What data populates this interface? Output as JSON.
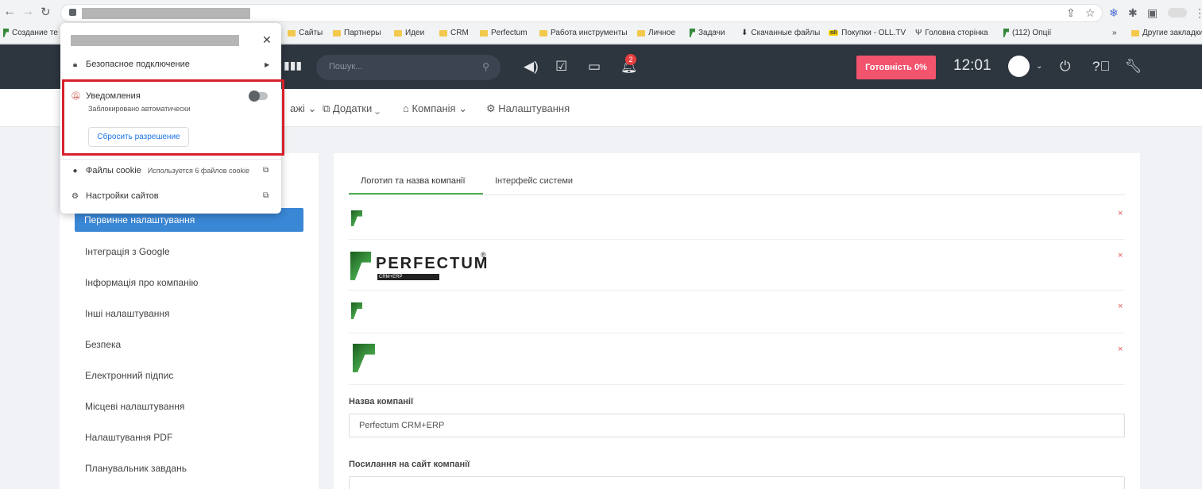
{
  "browser": {
    "bookmarks": [
      "Создание те",
      "Сайты",
      "Партнеры",
      "Идеи",
      "CRM",
      "Perfectum",
      "Работа инструменты",
      "Личное",
      "Задачи",
      "Скачанные файлы",
      "Покупки - OLL.TV",
      "Головна сторінка",
      "(112) Опції",
      "Другие закладки"
    ],
    "more_bookmarks": "»",
    "oll_badge": "oll"
  },
  "header": {
    "search_placeholder": "Пошук...",
    "notifications_count": "2",
    "readiness": "Готовність 0%",
    "clock": "12:01"
  },
  "topnav": {
    "items": [
      "ажі",
      "Додатки",
      "Компанія",
      "Налаштування"
    ]
  },
  "sidebar": {
    "active": "Первинне налаштування",
    "items": [
      "Інтеграція з Google",
      "Інформація про компанію",
      "Інші налаштування",
      "Безпека",
      "Електронний підпис",
      "Місцеві налаштування",
      "Налаштування PDF",
      "Планувальник завдань"
    ]
  },
  "main": {
    "tabs": [
      "Логотип та назва компанії",
      "Інтерфейс системи"
    ],
    "logo_wordmark": "PERFECTUM",
    "logo_reg": "®",
    "logo_tag": "CRM+ERP",
    "company_name_label": "Назва компанії",
    "company_name_value": "Perfectum CRM+ERP",
    "website_label": "Посилання на сайт компанії",
    "delete_glyph": "×"
  },
  "popup": {
    "secure": "Безопасное подключение",
    "notifications_title": "Уведомления",
    "notifications_sub": "Заблокировано автоматически",
    "reset_button": "Сбросить разрешение",
    "cookies_label": "Файлы cookie",
    "cookies_sub": "Используется 6 файлов cookie",
    "site_settings": "Настройки сайтов"
  },
  "colors": {
    "header_bg": "#2d353f",
    "accent_blue": "#3a87d6",
    "readiness_red": "#f2536d",
    "brand_green": "#43a047",
    "highlight_red": "#d7202c"
  }
}
